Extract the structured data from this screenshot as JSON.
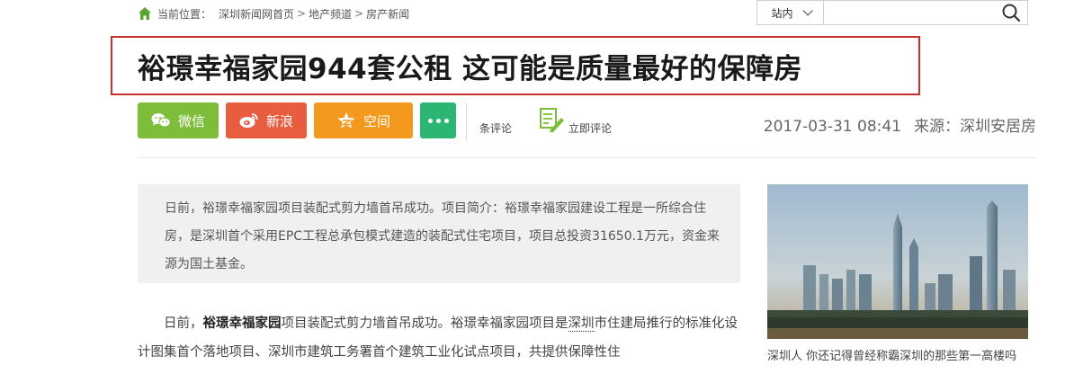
{
  "breadcrumb": {
    "label": "当前位置：",
    "items": [
      "深圳新闻网首页",
      "地产频道",
      "房产新闻"
    ],
    "separator": ">"
  },
  "search": {
    "scope": "站内",
    "placeholder": ""
  },
  "article": {
    "title": "裕璟幸福家园944套公租 这可能是质量最好的保障房",
    "datetime": "2017-03-31 08:41",
    "source": "来源：深圳安居房",
    "summary": "日前，裕璟幸福家园项目装配式剪力墙首吊成功。项目简介：裕璟幸福家园建设工程是一所综合住房，是深圳首个采用EPC工程总承包模式建造的装配式住宅项目，项目总投资31650.1万元，资金来源为国土基金。",
    "body": {
      "p1_lead": "日前，",
      "p1_bold": "裕璟幸福家园",
      "p1_mid": "项目装配式剪力墙首吊成功。裕璟幸福家园项目是",
      "p1_kw": "深圳",
      "p1_tail": "市住建局推行的标准化设计图集首个落地项目、深圳市建筑工务署首个建筑工业化试点项目，共提供保障性住"
    }
  },
  "share": {
    "wechat": "微信",
    "weibo": "新浪",
    "qzone": "空间"
  },
  "comments": {
    "count_label": "条评论",
    "comment_now": "立即评论"
  },
  "sidebar": {
    "caption": "深圳人 你还记得曾经称霸深圳的那些第一高楼吗"
  },
  "colors": {
    "title_border": "#c9302c",
    "wechat": "#7dbd3a",
    "weibo": "#e85d3f",
    "qzone": "#f39a1e",
    "more": "#2bb673",
    "home_icon": "#5aa532"
  }
}
